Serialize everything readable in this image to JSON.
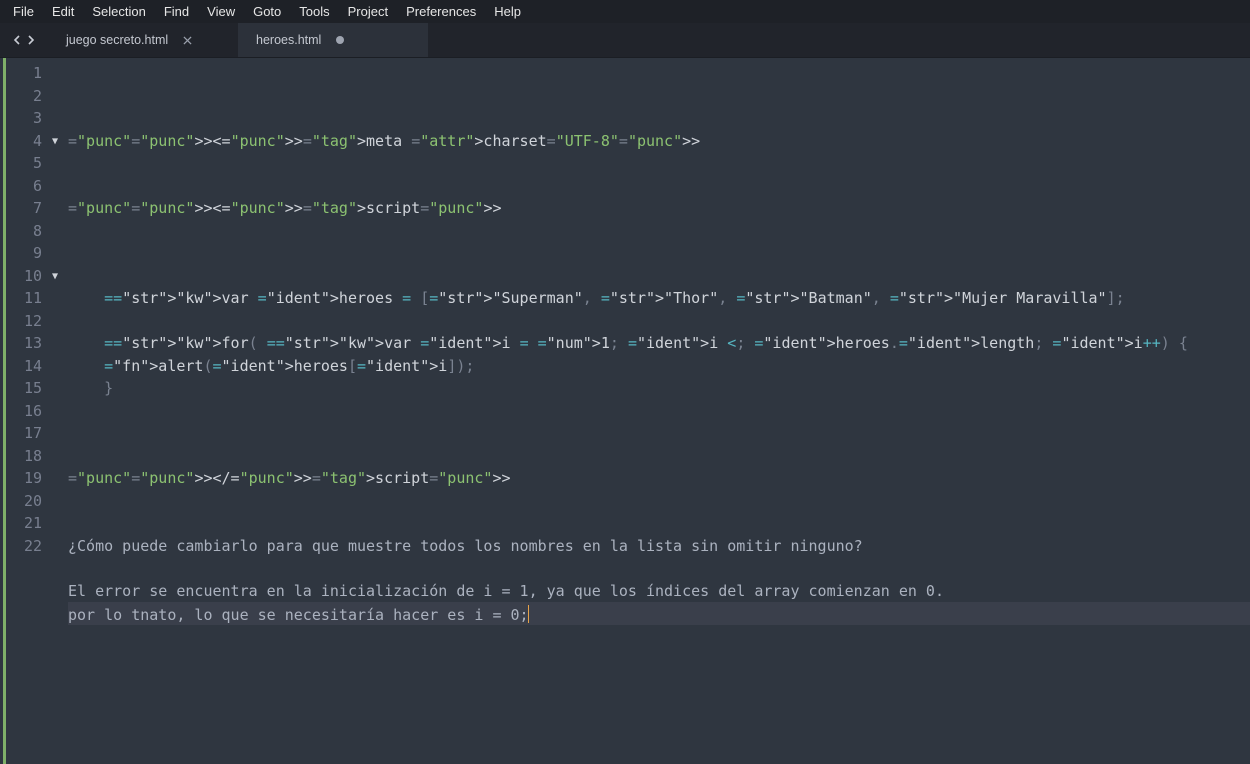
{
  "menu": [
    "File",
    "Edit",
    "Selection",
    "Find",
    "View",
    "Goto",
    "Tools",
    "Project",
    "Preferences",
    "Help"
  ],
  "tabs": [
    {
      "label": "juego secreto.html",
      "active": false,
      "dirty": false
    },
    {
      "label": "heroes.html",
      "active": true,
      "dirty": true
    }
  ],
  "editor": {
    "total_lines": 22,
    "fold_lines": [
      4,
      10
    ],
    "current_line": 22,
    "lines": {
      "1": "<meta charset=\"UTF-8\">",
      "2": "",
      "3": "",
      "4": "<script>",
      "5": "",
      "6": "",
      "7": "",
      "8": "    var heroes = [\"Superman\", \"Thor\", \"Batman\", \"Mujer Maravilla\"];",
      "9": "",
      "10": "    for( var i = 1; i < heroes.length; i++) {",
      "11": "    alert(heroes[i]);",
      "12": "    }",
      "13": "",
      "14": "",
      "15": "",
      "16": "</script>",
      "17": "",
      "18": "",
      "19": "¿Cómo puede cambiarlo para que muestre todos los nombres en la lista sin omitir ninguno?",
      "20": "",
      "21": "El error se encuentra en la inicialización de i = 1, ya que los índices del array comienzan en 0.",
      "22": "por lo tnato, lo que se necesitaría hacer es i = 0;"
    }
  },
  "colors": {
    "bg": "#2f3640",
    "tab_bg": "#21242b",
    "tab_active": "#2c313a",
    "menu_bg": "#1e2127",
    "accent_green": "#7fb069"
  }
}
